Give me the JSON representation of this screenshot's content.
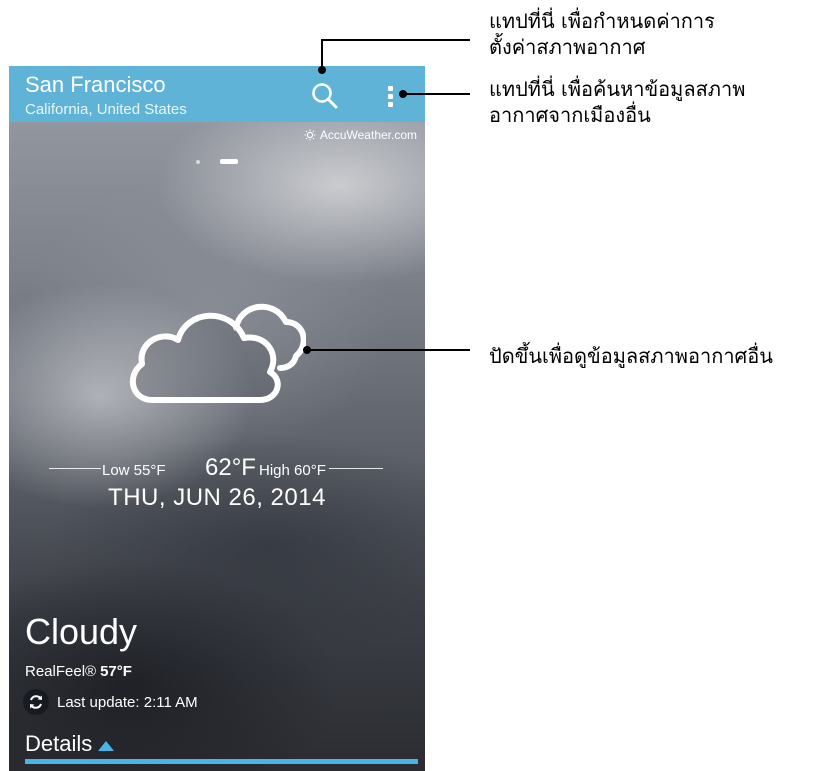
{
  "app_bar": {
    "city": "San Francisco",
    "region": "California, United States",
    "search_icon": "search-icon",
    "menu_icon": "more-vert-icon",
    "color": "#5fb3d6"
  },
  "provider": {
    "label": "AccuWeather.com",
    "icon": "sun-icon"
  },
  "pager": {
    "count": 2,
    "active_index": 1
  },
  "weather": {
    "icon": "cloudy-icon",
    "low": "Low 55°F",
    "current": "62°F",
    "high": "High 60°F",
    "date": "THU, JUN 26, 2014",
    "condition": "Cloudy",
    "realfeel_label": "RealFeel®",
    "realfeel_value": "57°F",
    "last_update": "Last update: 2:11 AM",
    "refresh_icon": "refresh-icon"
  },
  "details": {
    "label": "Details",
    "icon": "triangle-up-icon",
    "accent": "#49b4e6"
  },
  "annotations": {
    "search_note": [
      "แทปที่นี่ เพื่อกำหนดค่าการ",
      "ตั้งค่าสภาพอากาศ"
    ],
    "menu_note": [
      "แทปที่นี่ เพื่อค้นหาข้อมูลสภาพ",
      "อากาศจากเมืองอื่น"
    ],
    "swipe_note": "ปัดขึ้นเพื่อดูข้อมูลสภาพอากาศอื่น"
  }
}
